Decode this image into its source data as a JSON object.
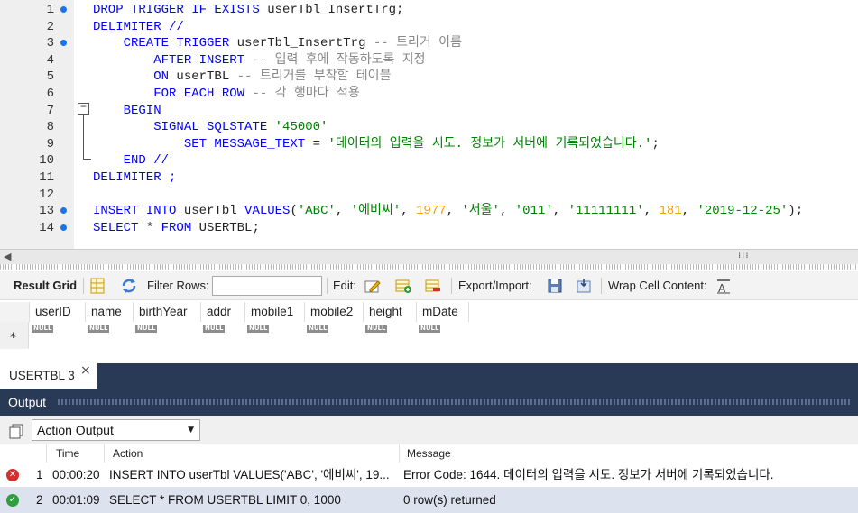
{
  "editor": {
    "lines": [
      {
        "n": "1",
        "bp": true,
        "segs": [
          {
            "t": "DROP TRIGGER IF EXISTS ",
            "c": "kw"
          },
          {
            "t": "userTbl_InsertTrg;",
            "c": ""
          }
        ]
      },
      {
        "n": "2",
        "bp": false,
        "segs": [
          {
            "t": "DELIMITER //",
            "c": "kw"
          }
        ]
      },
      {
        "n": "3",
        "bp": true,
        "segs": [
          {
            "t": "    CREATE TRIGGER ",
            "c": "kw"
          },
          {
            "t": "userTbl_InsertTrg ",
            "c": ""
          },
          {
            "t": "-- 트리거 이름",
            "c": "cm"
          }
        ]
      },
      {
        "n": "4",
        "bp": false,
        "segs": [
          {
            "t": "        AFTER INSERT ",
            "c": "kw"
          },
          {
            "t": "-- 입력 후에 작동하도록 지정",
            "c": "cm"
          }
        ]
      },
      {
        "n": "5",
        "bp": false,
        "segs": [
          {
            "t": "        ON ",
            "c": "kw"
          },
          {
            "t": "userTBL ",
            "c": ""
          },
          {
            "t": "-- 트리거를 부착할 테이블",
            "c": "cm"
          }
        ]
      },
      {
        "n": "6",
        "bp": false,
        "segs": [
          {
            "t": "        FOR EACH ROW ",
            "c": "kw"
          },
          {
            "t": "-- 각 행마다 적용",
            "c": "cm"
          }
        ]
      },
      {
        "n": "7",
        "bp": false,
        "segs": [
          {
            "t": "    BEGIN",
            "c": "kw"
          }
        ]
      },
      {
        "n": "8",
        "bp": false,
        "segs": [
          {
            "t": "        SIGNAL SQLSTATE ",
            "c": "kw"
          },
          {
            "t": "'45000'",
            "c": "str"
          }
        ]
      },
      {
        "n": "9",
        "bp": false,
        "segs": [
          {
            "t": "            SET MESSAGE_TEXT ",
            "c": "kw"
          },
          {
            "t": "= ",
            "c": ""
          },
          {
            "t": "'데이터의 입력을 시도. 정보가 서버에 기록되었습니다.'",
            "c": "str"
          },
          {
            "t": ";",
            "c": ""
          }
        ]
      },
      {
        "n": "10",
        "bp": false,
        "segs": [
          {
            "t": "    END //",
            "c": "kw"
          }
        ]
      },
      {
        "n": "11",
        "bp": false,
        "segs": [
          {
            "t": "DELIMITER ;",
            "c": "kw"
          }
        ]
      },
      {
        "n": "12",
        "bp": false,
        "segs": []
      },
      {
        "n": "13",
        "bp": true,
        "segs": [
          {
            "t": "INSERT INTO ",
            "c": "kw"
          },
          {
            "t": "userTbl ",
            "c": ""
          },
          {
            "t": "VALUES",
            "c": "kw"
          },
          {
            "t": "(",
            "c": ""
          },
          {
            "t": "'ABC'",
            "c": "str"
          },
          {
            "t": ", ",
            "c": ""
          },
          {
            "t": "'에비씨'",
            "c": "str"
          },
          {
            "t": ", ",
            "c": ""
          },
          {
            "t": "1977",
            "c": "num"
          },
          {
            "t": ", ",
            "c": ""
          },
          {
            "t": "'서울'",
            "c": "str"
          },
          {
            "t": ", ",
            "c": ""
          },
          {
            "t": "'011'",
            "c": "str"
          },
          {
            "t": ", ",
            "c": ""
          },
          {
            "t": "'11111111'",
            "c": "str"
          },
          {
            "t": ", ",
            "c": ""
          },
          {
            "t": "181",
            "c": "num"
          },
          {
            "t": ", ",
            "c": ""
          },
          {
            "t": "'2019-12-25'",
            "c": "str"
          },
          {
            "t": ");",
            "c": ""
          }
        ]
      },
      {
        "n": "14",
        "bp": true,
        "segs": [
          {
            "t": "SELECT ",
            "c": "kw"
          },
          {
            "t": "* ",
            "c": ""
          },
          {
            "t": "FROM ",
            "c": "kw"
          },
          {
            "t": "USERTBL;",
            "c": ""
          }
        ]
      }
    ]
  },
  "toolbar": {
    "result_grid": "Result Grid",
    "filter_rows": "Filter Rows:",
    "edit": "Edit:",
    "export_import": "Export/Import:",
    "wrap_cell": "Wrap Cell Content:"
  },
  "grid": {
    "columns": [
      "userID",
      "name",
      "birthYear",
      "addr",
      "mobile1",
      "mobile2",
      "height",
      "mDate"
    ],
    "null_text": "NULL"
  },
  "tabs": {
    "result_tab": "USERTBL 3",
    "close": "×"
  },
  "output": {
    "title": "Output",
    "dropdown_value": "Action Output",
    "headers": {
      "time": "Time",
      "action": "Action",
      "message": "Message"
    },
    "rows": [
      {
        "status": "error",
        "num": "1",
        "time": "00:00:20",
        "action": "INSERT INTO userTbl VALUES('ABC', '에비씨', 19...",
        "message": "Error Code: 1644. 데이터의 입력을 시도. 정보가 서버에 기록되었습니다."
      },
      {
        "status": "ok",
        "num": "2",
        "time": "00:01:09",
        "action": "SELECT * FROM USERTBL LIMIT 0, 1000",
        "message": "0 row(s) returned"
      }
    ]
  },
  "colors": {
    "keyword": "#0000ff",
    "string": "#008000",
    "number": "#f0a000",
    "comment": "#888888",
    "panel": "#283a55",
    "error": "#d32f2f",
    "ok": "#2e9e3e"
  }
}
